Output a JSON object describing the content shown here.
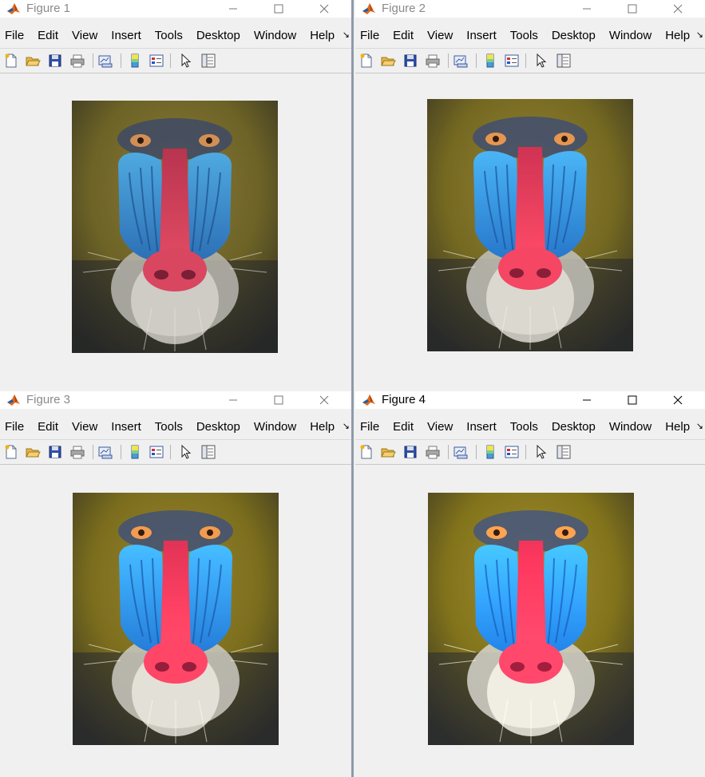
{
  "menu_labels": [
    "File",
    "Edit",
    "View",
    "Insert",
    "Tools",
    "Desktop",
    "Window",
    "Help"
  ],
  "menu_more_glyph": "↘",
  "toolbar_icons": [
    "new-figure-icon",
    "open-file-icon",
    "save-icon",
    "print-icon",
    "link-plot-icon",
    "colorbar-icon",
    "legend-icon",
    "edit-plot-icon",
    "property-inspector-icon"
  ],
  "figures": [
    {
      "title": "Figure 1"
    },
    {
      "title": "Figure 2"
    },
    {
      "title": "Figure 3"
    },
    {
      "title": "Figure 4"
    }
  ],
  "colors": {
    "matlab_logo_orange": "#e16a1c",
    "matlab_logo_blue": "#1f5fa8"
  }
}
